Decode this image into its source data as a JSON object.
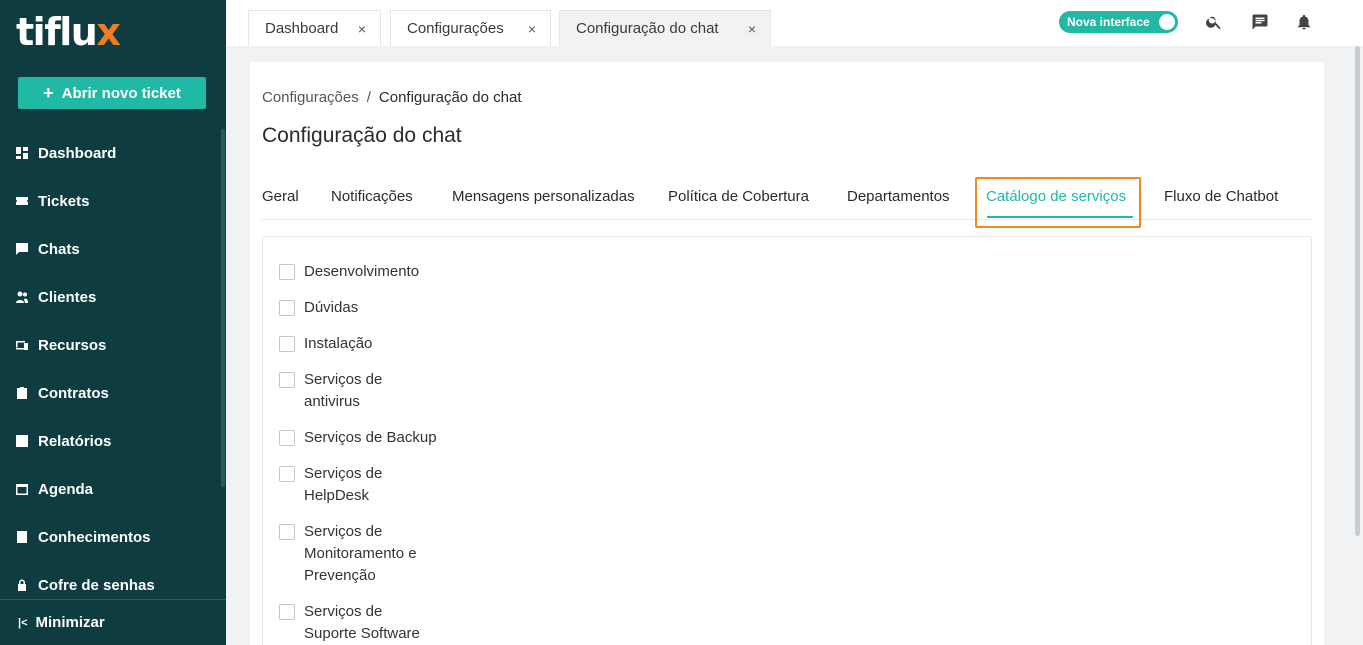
{
  "app": {
    "logo_main": "tiflu",
    "logo_accent": "x"
  },
  "sidebar": {
    "new_ticket_label": "Abrir novo ticket",
    "items": [
      {
        "label": "Dashboard",
        "icon": "dashboard-icon"
      },
      {
        "label": "Tickets",
        "icon": "ticket-icon"
      },
      {
        "label": "Chats",
        "icon": "chat-icon"
      },
      {
        "label": "Clientes",
        "icon": "clients-icon"
      },
      {
        "label": "Recursos",
        "icon": "devices-icon"
      },
      {
        "label": "Contratos",
        "icon": "contract-icon"
      },
      {
        "label": "Relatórios",
        "icon": "report-icon"
      },
      {
        "label": "Agenda",
        "icon": "calendar-icon"
      },
      {
        "label": "Conhecimentos",
        "icon": "book-icon"
      },
      {
        "label": "Cofre de senhas",
        "icon": "lock-icon"
      }
    ],
    "minimize_label": "Minimizar"
  },
  "topbar": {
    "tabs": [
      {
        "label": "Dashboard"
      },
      {
        "label": "Configurações"
      },
      {
        "label": "Configuração do chat"
      }
    ],
    "close_glyph": "×",
    "toggle_label": "Nova interface",
    "toggle_on": true
  },
  "main": {
    "breadcrumb": {
      "parent": "Configurações",
      "separator": "/",
      "current": "Configuração do chat"
    },
    "title": "Configuração do chat",
    "tabs": [
      {
        "label": "Geral"
      },
      {
        "label": "Notificações"
      },
      {
        "label": "Mensagens personalizadas"
      },
      {
        "label": "Política de Cobertura"
      },
      {
        "label": "Departamentos"
      },
      {
        "label": "Catálogo de serviços"
      },
      {
        "label": "Fluxo de Chatbot"
      }
    ],
    "active_tab": "Catálogo de serviços",
    "options": [
      {
        "label": "Desenvolvimento",
        "checked": false
      },
      {
        "label": "Dúvidas",
        "checked": false
      },
      {
        "label": "Instalação",
        "checked": false
      },
      {
        "label": "Serviços de antivirus",
        "checked": false
      },
      {
        "label": "Serviços de Backup",
        "checked": false
      },
      {
        "label": "Serviços de HelpDesk",
        "checked": false
      },
      {
        "label": "Serviços de Monitoramento e Prevenção",
        "checked": false
      },
      {
        "label": "Serviços de Suporte Software",
        "checked": false
      }
    ]
  },
  "colors": {
    "sidebar": "#0e3c40",
    "accent": "#1fb9a5",
    "highlight": "#f0891e"
  }
}
